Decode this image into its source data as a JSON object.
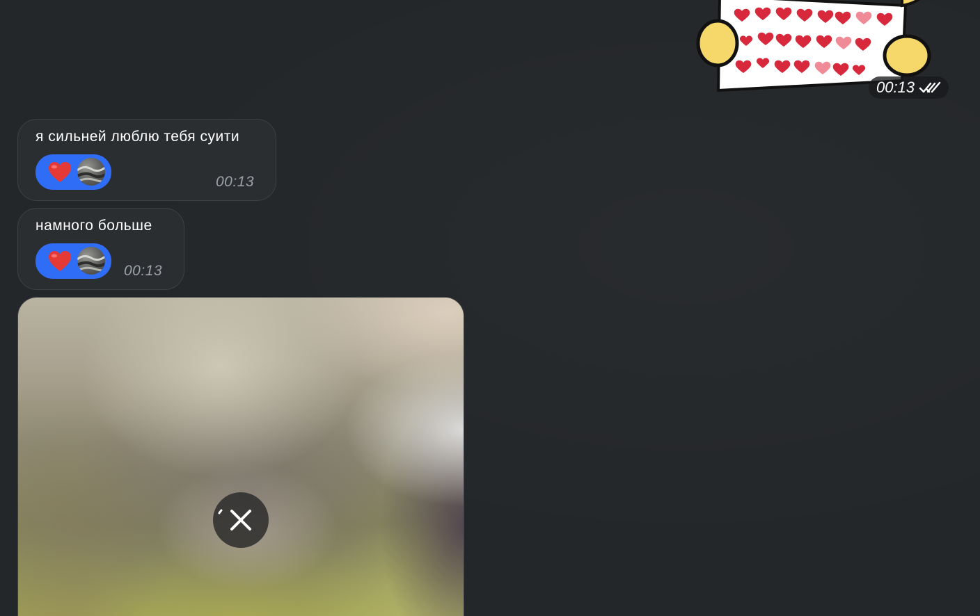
{
  "colors": {
    "background": "#24272a",
    "bubble": "#2b2e31",
    "reaction": "#2f6df6",
    "time": "#9da2a8",
    "heart": "#e53935"
  },
  "sticker": {
    "icon": "hearts-letter-sticker",
    "time": "00:13",
    "status_icon": "double-check-icon"
  },
  "messages": [
    {
      "text": "я сильней люблю тебя суити",
      "reaction_emoji": "heart-icon",
      "time": "00:13"
    },
    {
      "text": "намного больше",
      "reaction_emoji": "heart-icon",
      "time": "00:13"
    }
  ],
  "media": {
    "type": "blurred-photo-loading",
    "cancel_icon": "close-icon"
  }
}
